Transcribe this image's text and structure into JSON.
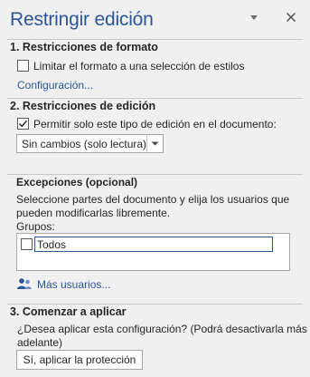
{
  "pane": {
    "title": "Restringir edición"
  },
  "formatting": {
    "heading": "1. Restricciones de formato",
    "checkbox_label": "Limitar el formato a una selección de estilos",
    "checkbox_checked": false,
    "settings_link": "Configuración..."
  },
  "editing": {
    "heading": "2. Restricciones de edición",
    "checkbox_label": "Permitir solo este tipo de edición en el documento:",
    "checkbox_checked": true,
    "dropdown_value": "Sin cambios (solo lectura)"
  },
  "exceptions": {
    "heading": "Excepciones (opcional)",
    "description_line1": "Seleccione partes del documento y elija los usuarios que",
    "description_line2": "pueden modificarlas libremente.",
    "groups_label": "Grupos:",
    "groups": [
      {
        "name": "Todos",
        "checked": false
      }
    ],
    "more_users_link": "Más usuarios..."
  },
  "apply": {
    "heading": "3. Comenzar a aplicar",
    "question_line1": "¿Desea aplicar esta configuración? (Podrá desactivarla más",
    "question_line2": "adelante)",
    "button_label": "Sí, aplicar la protección"
  },
  "colors": {
    "accent": "#2b579a",
    "background": "#f0f0f0"
  }
}
